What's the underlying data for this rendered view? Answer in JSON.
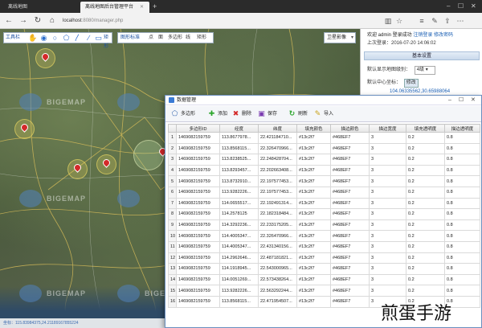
{
  "browser": {
    "tabs": [
      {
        "label": "离线地图",
        "active": false
      },
      {
        "label": "离线地图后台管理平台",
        "active": true
      }
    ],
    "url_host": "localhost",
    "url_path": ":8080/manager.php"
  },
  "map_toolbar": {
    "draw_label": "工具栏",
    "layer_label": "图形标准",
    "layer_items": [
      "点",
      "面",
      "多边形",
      "线",
      "矩形"
    ],
    "rect_label": "矩形",
    "map_type": "卫星影像"
  },
  "watermark": "BIGEMAP",
  "status_coords": "坐标：115.83984375,24.21189167855224",
  "side": {
    "welcome": "欢迎 admin 登录成功",
    "link_logout": "注销登录",
    "link_password": "修改密码",
    "last_login": "上次登录：2016-07-20 14:06:02",
    "section": "基本设置",
    "level_label": "默认显示地图级别：",
    "level_value": "4级",
    "center_label": "默认中心坐标：",
    "center_button": "修改",
    "center_value": "104.06335562,30.65988064"
  },
  "dialog": {
    "title": "数据管理",
    "toolbar": [
      {
        "label": "多边形",
        "icon": "polygon-icon"
      },
      {
        "label": "添加",
        "icon": "plus-icon"
      },
      {
        "label": "删除",
        "icon": "delete-icon"
      },
      {
        "label": "保存",
        "icon": "save-icon"
      },
      {
        "label": "刷新",
        "icon": "refresh-icon"
      },
      {
        "label": "导入",
        "icon": "import-icon"
      }
    ],
    "columns": [
      "",
      "多边形ID",
      "经度",
      "纬度",
      "填充颜色",
      "描边颜色",
      "描边宽度",
      "填充透明度",
      "描边透明度"
    ],
    "rows": [
      [
        "1",
        "1469082159759",
        "113.8677978...",
        "22.421184710...",
        "#13c2f7",
        "#468EF7",
        "3",
        "0.2",
        "0.8"
      ],
      [
        "2",
        "1469082159759",
        "113.8568115...",
        "22.326470966...",
        "#13c2f7",
        "#468EF7",
        "3",
        "0.2",
        "0.8"
      ],
      [
        "3",
        "1469082159759",
        "113.8238525...",
        "22.248428704...",
        "#13c2f7",
        "#468EF7",
        "3",
        "0.2",
        "0.8"
      ],
      [
        "4",
        "1469082159759",
        "113.8293457...",
        "22.202663408...",
        "#13c2f7",
        "#468EF7",
        "3",
        "0.2",
        "0.8"
      ],
      [
        "5",
        "1469082159759",
        "113.8732910...",
        "22.197577453...",
        "#13c2f7",
        "#468EF7",
        "3",
        "0.2",
        "0.8"
      ],
      [
        "6",
        "1469082159759",
        "113.9282226...",
        "22.197577453...",
        "#13c2f7",
        "#468EF7",
        "3",
        "0.2",
        "0.8"
      ],
      [
        "7",
        "1469082159759",
        "114.0655517...",
        "22.192491314...",
        "#13c2f7",
        "#468EF7",
        "3",
        "0.2",
        "0.8"
      ],
      [
        "8",
        "1469082159759",
        "114.2578125",
        "22.182318484...",
        "#13c2f7",
        "#468EF7",
        "3",
        "0.2",
        "0.8"
      ],
      [
        "9",
        "1469082159759",
        "114.3292236...",
        "22.233175205...",
        "#13c2f7",
        "#468EF7",
        "3",
        "0.2",
        "0.8"
      ],
      [
        "10",
        "1469082159759",
        "114.4005347...",
        "22.326470966...",
        "#13c2f7",
        "#468EF7",
        "3",
        "0.2",
        "0.8"
      ],
      [
        "11",
        "1469082159759",
        "114.4005347...",
        "22.431340156...",
        "#13c2f7",
        "#468EF7",
        "3",
        "0.2",
        "0.8"
      ],
      [
        "12",
        "1469082159759",
        "114.2962646...",
        "22.487181821...",
        "#13c2f7",
        "#468EF7",
        "3",
        "0.2",
        "0.8"
      ],
      [
        "13",
        "1469082159759",
        "114.1918945...",
        "22.543000965...",
        "#13c2f7",
        "#468EF7",
        "3",
        "0.2",
        "0.8"
      ],
      [
        "14",
        "1469082159759",
        "114.0051269...",
        "22.573438264...",
        "#13c2f7",
        "#468EF7",
        "3",
        "0.2",
        "0.8"
      ],
      [
        "15",
        "1469082159759",
        "113.9282226...",
        "22.563292244...",
        "#13c2f7",
        "#468EF7",
        "3",
        "0.2",
        "0.8"
      ],
      [
        "16",
        "1469082159759",
        "113.8568115...",
        "22.471954507...",
        "#13c2f7",
        "#468EF7",
        "3",
        "0.2",
        "0.8"
      ]
    ]
  },
  "brand_text": "煎蛋手游"
}
